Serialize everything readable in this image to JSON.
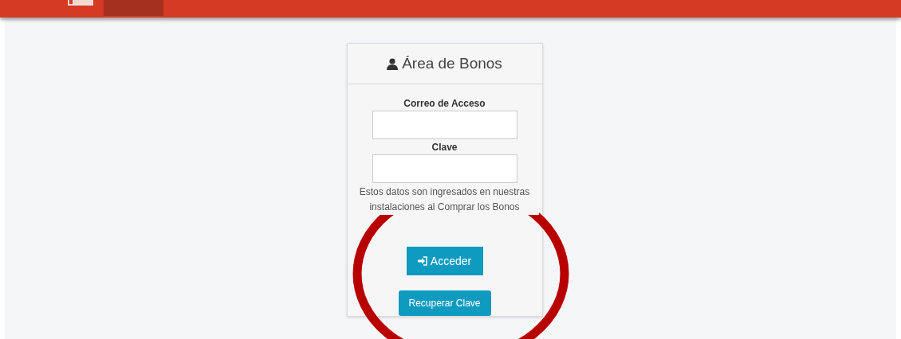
{
  "card": {
    "title": "Área de Bonos",
    "fields": [
      {
        "label": "Correo de Acceso"
      },
      {
        "label": "Clave"
      }
    ],
    "note": "Estos datos son ingresados en nuestras instalaciones al Comprar los Bonos",
    "buttons": [
      {
        "label": "Acceder",
        "kind": "primary"
      },
      {
        "label": "Recuperar Clave",
        "kind": "secondary"
      }
    ]
  }
}
